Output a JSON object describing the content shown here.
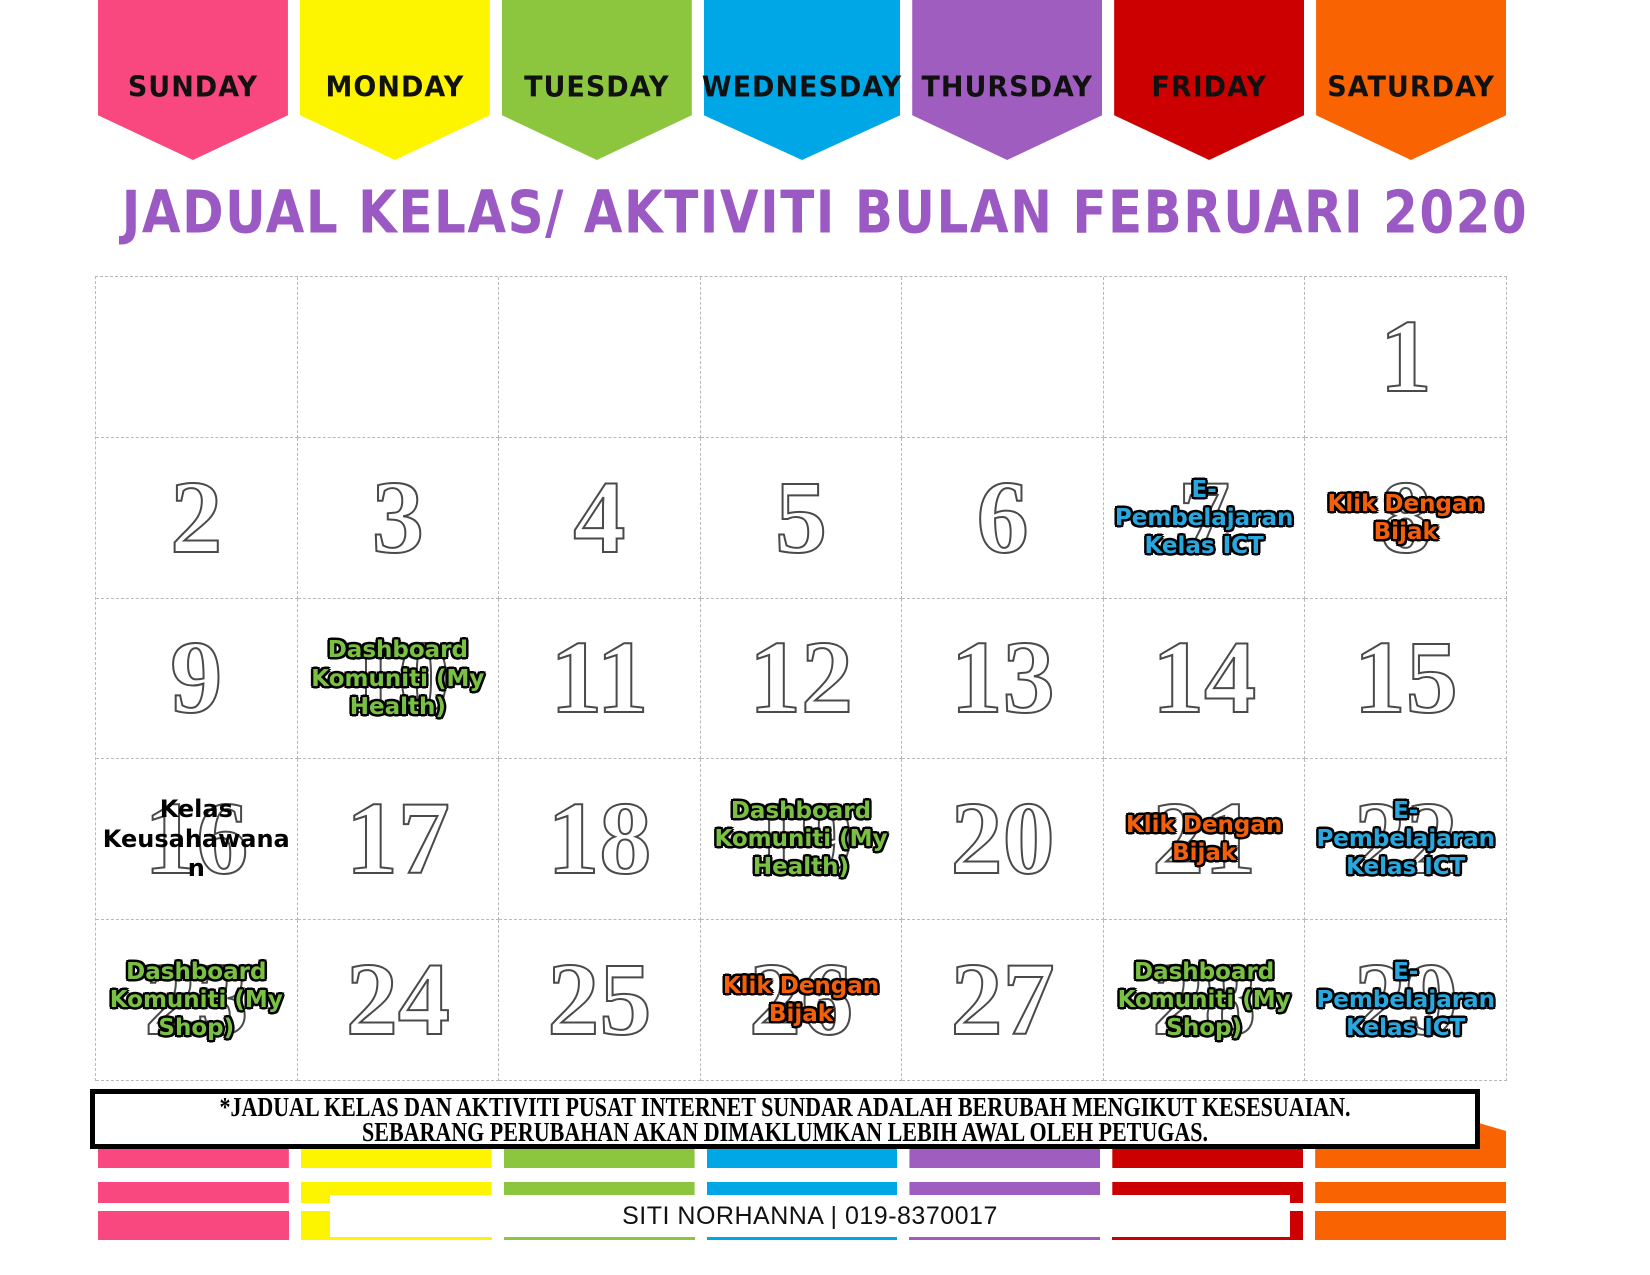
{
  "header": {
    "days": [
      {
        "label": "SUNDAY",
        "color": "#f9487f"
      },
      {
        "label": "MONDAY",
        "color": "#fdf400"
      },
      {
        "label": "TUESDAY",
        "color": "#8cc63f"
      },
      {
        "label": "WEDNESDAY",
        "color": "#00a7e6"
      },
      {
        "label": "THURSDAY",
        "color": "#a css"
      }
    ]
  },
  "title": "JADUAL KELAS/ AKTIVITI BULAN FEBRUARI 2020",
  "colors": {
    "sunday": "#f9487f",
    "monday": "#fdf400",
    "tuesday": "#8cc63f",
    "wednesday": "#00a7e6",
    "thursday": "#a濃",
    "title_purple": "#9b59c4",
    "event_blue": "#29a8e0",
    "event_orange": "#f4600a",
    "event_green": "#7ac143"
  },
  "days_of_week": [
    "SUNDAY",
    "MONDAY",
    "TUESDAY",
    "WEDNESDAY",
    "THURSDAY",
    "FRIDAY",
    "SATURDAY"
  ],
  "day_colors": [
    "#f9487f",
    "#fdf400",
    "#8cc63f",
    "#00a7e6",
    "#a05dc0",
    "#cc0000",
    "#f96302"
  ],
  "cells": [
    {
      "date": "",
      "event": "",
      "style": ""
    },
    {
      "date": "",
      "event": "",
      "style": ""
    },
    {
      "date": "",
      "event": "",
      "style": ""
    },
    {
      "date": "",
      "event": "",
      "style": ""
    },
    {
      "date": "",
      "event": "",
      "style": ""
    },
    {
      "date": "",
      "event": "",
      "style": ""
    },
    {
      "date": "1",
      "event": "",
      "style": ""
    },
    {
      "date": "2",
      "event": "",
      "style": ""
    },
    {
      "date": "3",
      "event": "",
      "style": ""
    },
    {
      "date": "4",
      "event": "",
      "style": ""
    },
    {
      "date": "5",
      "event": "",
      "style": ""
    },
    {
      "date": "6",
      "event": "",
      "style": ""
    },
    {
      "date": "7",
      "event": "E-Pembelajaran Kelas ICT",
      "style": "blue"
    },
    {
      "date": "8",
      "event": "Klik Dengan Bijak",
      "style": "orange"
    },
    {
      "date": "9",
      "event": "",
      "style": ""
    },
    {
      "date": "10",
      "event": "Dashboard Komuniti (My Health)",
      "style": "green"
    },
    {
      "date": "11",
      "event": "",
      "style": ""
    },
    {
      "date": "12",
      "event": "",
      "style": ""
    },
    {
      "date": "13",
      "event": "",
      "style": ""
    },
    {
      "date": "14",
      "event": "",
      "style": ""
    },
    {
      "date": "15",
      "event": "",
      "style": ""
    },
    {
      "date": "16",
      "event": "Kelas Keusahawanan",
      "style": "black"
    },
    {
      "date": "17",
      "event": "",
      "style": ""
    },
    {
      "date": "18",
      "event": "",
      "style": ""
    },
    {
      "date": "19",
      "event": "Dashboard Komuniti (My Health)",
      "style": "green"
    },
    {
      "date": "20",
      "event": "",
      "style": ""
    },
    {
      "date": "21",
      "event": "Klik Dengan Bijak",
      "style": "orange"
    },
    {
      "date": "22",
      "event": "E-Pembelajaran Kelas ICT",
      "style": "blue"
    },
    {
      "date": "23",
      "event": "Dashboard Komuniti (My Shop)",
      "style": "green"
    },
    {
      "date": "24",
      "event": "",
      "style": ""
    },
    {
      "date": "25",
      "event": "",
      "style": ""
    },
    {
      "date": "26",
      "event": "Klik Dengan Bijak",
      "style": "orange"
    },
    {
      "date": "27",
      "event": "",
      "style": ""
    },
    {
      "date": "28",
      "event": "Dashboard Komuniti (My Shop)",
      "style": "green"
    },
    {
      "date": "29",
      "event": "E-Pembelajaran Kelas  ICT",
      "style": "blue"
    }
  ],
  "footer": {
    "note_line1": "*JADUAL KELAS DAN AKTIVITI PUSAT INTERNET SUNDAR ADALAH BERUBAH MENGIKUT KESESUAIAN.",
    "note_line2": "SEBARANG PERUBAHAN AKAN DIMAKLUMKAN LEBIH AWAL OLEH PETUGAS.",
    "contact": "SITI NORHANNA | 019-8370017"
  }
}
